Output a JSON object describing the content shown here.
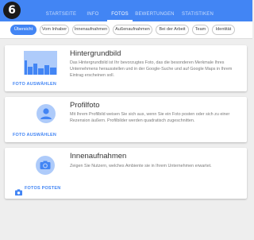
{
  "step_badge": "6",
  "nav": {
    "tabs": [
      {
        "label": "STARTSEITE",
        "active": false
      },
      {
        "label": "INFO",
        "active": false
      },
      {
        "label": "FOTOS",
        "active": true
      },
      {
        "label": "BEWERTUNGEN",
        "active": false
      },
      {
        "label": "STATISTIKEN",
        "active": false
      }
    ]
  },
  "filters": [
    {
      "label": "Übersicht",
      "active": true
    },
    {
      "label": "Vom Inhaber",
      "active": false
    },
    {
      "label": "Innenaufnahmen",
      "active": false
    },
    {
      "label": "Außenaufnahmen",
      "active": false
    },
    {
      "label": "Bei der Arbeit",
      "active": false
    },
    {
      "label": "Team",
      "active": false
    },
    {
      "label": "Identität",
      "active": false
    }
  ],
  "cards": {
    "cover": {
      "title": "Hintergrundbild",
      "description": "Das Hintergrundbild ist Ihr bevorzugtes Foto, das die besonderen Merkmale Ihres Unternehmens herausstellen und in der Google-Suche und auf Google Maps in Ihrem Eintrag erscheinen soll.",
      "action": "FOTO AUSWÄHLEN",
      "icon": "city-skyline-icon"
    },
    "profile": {
      "title": "Profilfoto",
      "description": "Mit Ihrem Profilbild weisen Sie sich aus, wenn Sie ein Foto posten oder sich zu einer Rezension äußern. Profilbilder werden quadratisch zugeschnitten.",
      "action": "FOTO AUSWÄHLEN",
      "icon": "person-icon"
    },
    "interior": {
      "title": "Innenaufnahmen",
      "description": "Zeigen Sie Nutzern, welches Ambiente sie in Ihrem Unternehmen erwartet.",
      "action": "FOTOS POSTEN",
      "icon": "camera-icon"
    }
  },
  "colors": {
    "accent": "#4285f4",
    "accent_light": "#aecbfa",
    "background": "#eeeeee"
  }
}
